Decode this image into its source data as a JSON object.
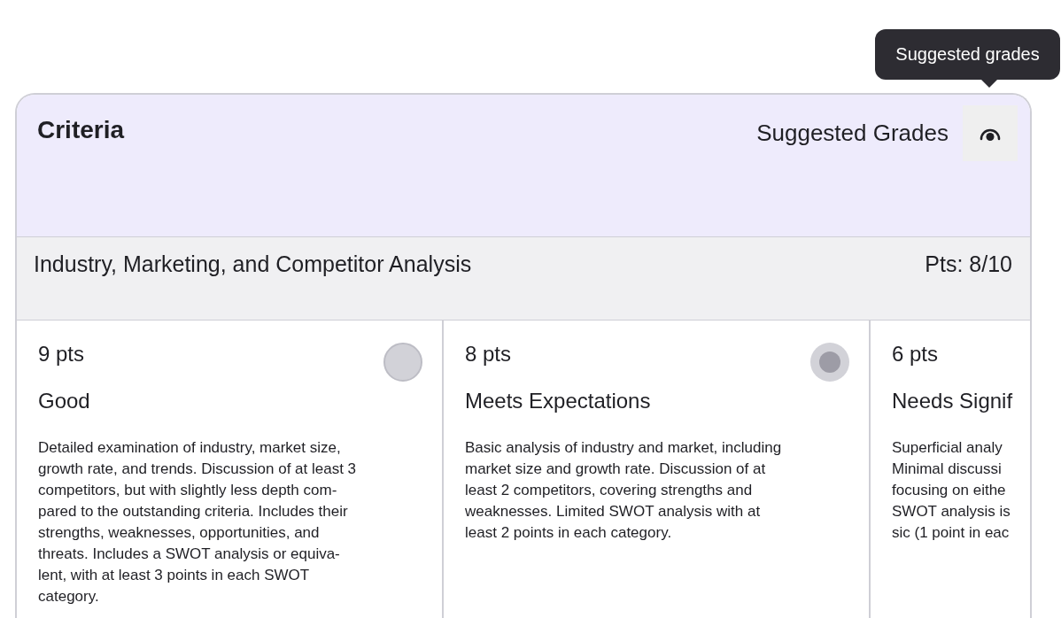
{
  "tooltip": "Suggested grades",
  "header": {
    "title": "Criteria",
    "suggested_label": "Suggested Grades"
  },
  "criterion": {
    "name": "Industry, Marketing, and Competitor Analysis",
    "points": "Pts: 8/10"
  },
  "levels": [
    {
      "points": "9 pts",
      "title": "Good",
      "selected": false,
      "description": "Detailed examination of industry, market size,\ngrowth rate, and trends. Discussion of at least 3\ncompetitors, but with slightly less depth com-\npared to the outstanding criteria. Includes their\nstrengths, weaknesses, opportunities, and\nthreats. Includes a SWOT analysis or equiva-\nlent, with at least 3 points in each SWOT\ncategory."
    },
    {
      "points": "8 pts",
      "title": "Meets Expectations",
      "selected": true,
      "description": "Basic analysis of industry and market, including\nmarket size and growth rate. Discussion of at\nleast 2 competitors, covering strengths and\nweaknesses. Limited SWOT analysis with at\nleast 2 points in each category."
    },
    {
      "points": "6 pts",
      "title": "Needs Signif",
      "description": "Superficial analy\nMinimal discussi\nfocusing on eithe\nSWOT analysis is\nsic (1 point in eac"
    }
  ]
}
